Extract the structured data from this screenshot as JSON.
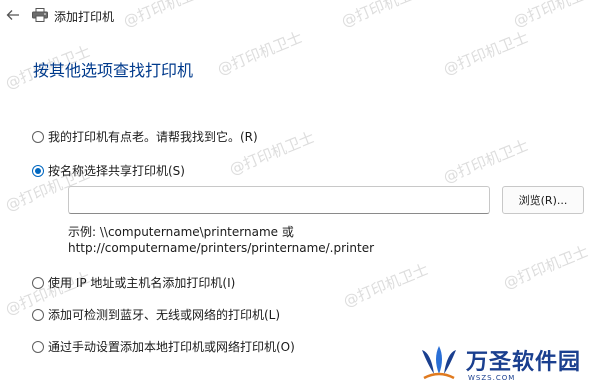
{
  "window": {
    "title": "添加打印机"
  },
  "heading": "按其他选项查找打印机",
  "options": [
    {
      "label": "我的打印机有点老。请帮我找到它。(R)",
      "checked": false
    },
    {
      "label": "按名称选择共享打印机(S)",
      "checked": true
    },
    {
      "label": "使用 IP 地址或主机名添加打印机(I)",
      "checked": false
    },
    {
      "label": "添加可检测到蓝牙、无线或网络的打印机(L)",
      "checked": false
    },
    {
      "label": "通过手动设置添加本地打印机或网络打印机(O)",
      "checked": false
    }
  ],
  "share_input": {
    "value": "",
    "placeholder": ""
  },
  "browse_label": "浏览(R)...",
  "example": {
    "line1": "示例: \\\\computername\\printername 或",
    "line2": "http://computername/printers/printername/.printer"
  },
  "watermark_text": "@打印机卫士",
  "logo": {
    "name": "万圣软件园",
    "domain": "WSZS.COM"
  }
}
